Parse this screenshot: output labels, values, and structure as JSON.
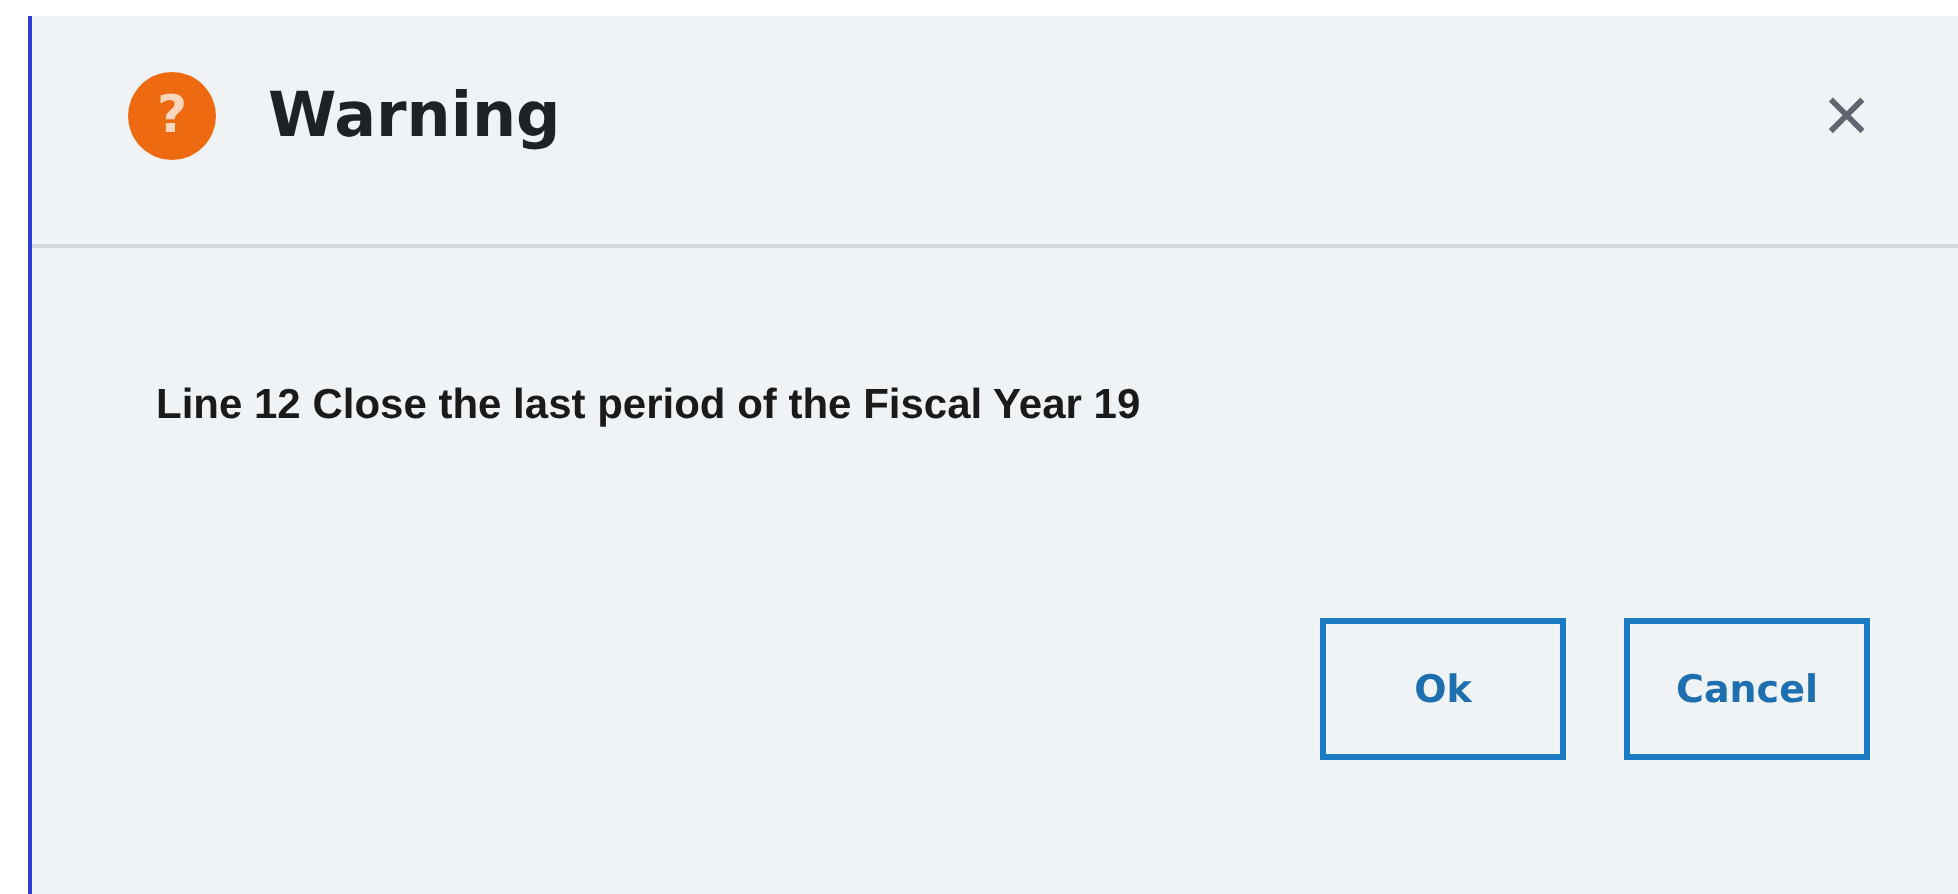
{
  "dialog": {
    "icon_glyph": "?",
    "title": "Warning",
    "close_glyph": "×",
    "message": "Line 12 Close the last period of the Fiscal Year 19",
    "buttons": [
      {
        "label": "Ok"
      },
      {
        "label": "Cancel"
      }
    ]
  }
}
